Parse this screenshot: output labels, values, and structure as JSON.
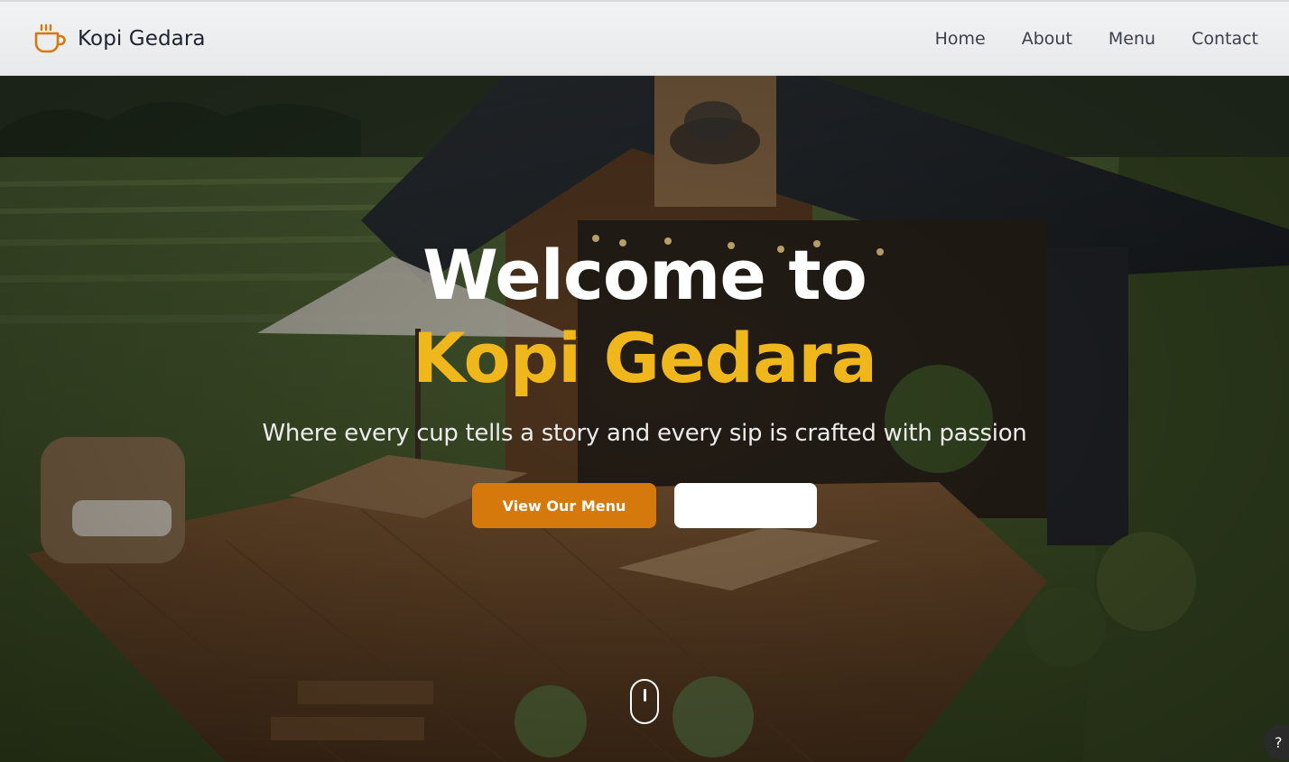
{
  "brand": {
    "name": "Kopi Gedara",
    "icon": "coffee-cup-icon"
  },
  "nav": {
    "items": [
      {
        "label": "Home"
      },
      {
        "label": "About"
      },
      {
        "label": "Menu"
      },
      {
        "label": "Contact"
      }
    ]
  },
  "hero": {
    "title_line1": "Welcome to",
    "title_line2": "Kopi Gedara",
    "subtitle": "Where every cup tells a story and every sip is crafted with passion",
    "primary_button": "View Our Menu",
    "secondary_button": "",
    "scroll_icon": "mouse-scroll-icon"
  },
  "help": {
    "label": "?"
  },
  "colors": {
    "accent": "#f0b71c",
    "button_primary": "#d5790d",
    "icon_orange": "#d5790d"
  }
}
